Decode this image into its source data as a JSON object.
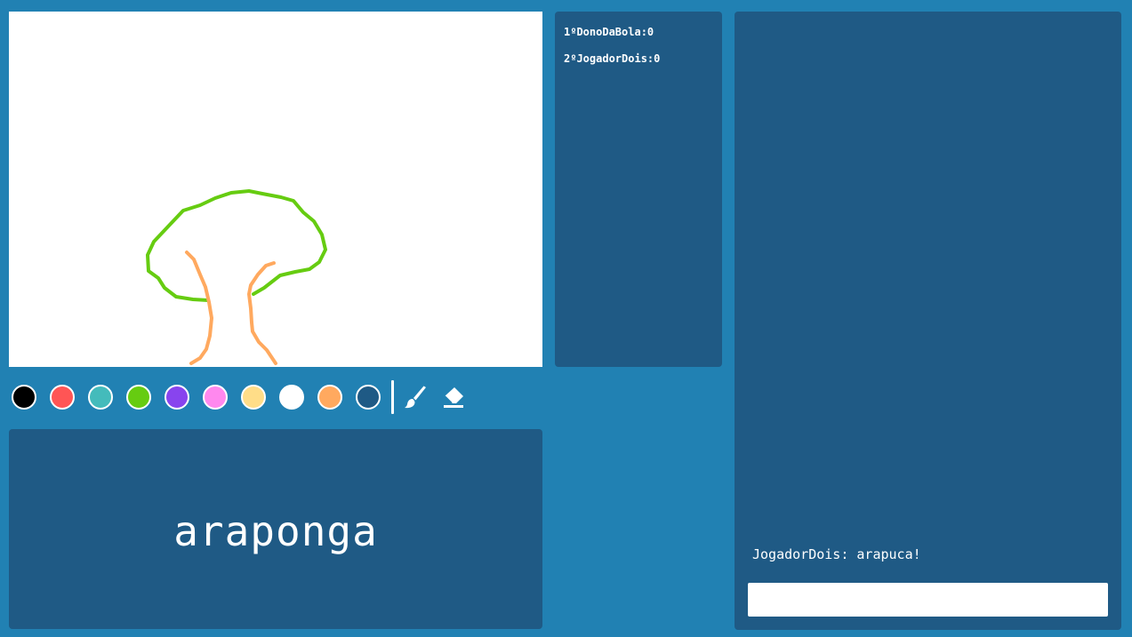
{
  "colors": {
    "background": "#2181b3",
    "panel": "#1f5a85",
    "canvas": "#ffffff",
    "stroke_green": "#66cc11",
    "stroke_orange": "#ffa95f"
  },
  "palette": [
    {
      "name": "black",
      "color": "#000000"
    },
    {
      "name": "red",
      "color": "#ff5555"
    },
    {
      "name": "teal",
      "color": "#44bbbb"
    },
    {
      "name": "green",
      "color": "#66cc11"
    },
    {
      "name": "purple",
      "color": "#8844ee"
    },
    {
      "name": "pink",
      "color": "#ff88ee"
    },
    {
      "name": "yellow",
      "color": "#ffdd88"
    },
    {
      "name": "white",
      "color": "#ffffff"
    },
    {
      "name": "orange",
      "color": "#ffa95f"
    },
    {
      "name": "navy",
      "color": "#1f5a85"
    }
  ],
  "tools": {
    "brush_icon": "brush-icon",
    "eraser_icon": "eraser-icon"
  },
  "word": "araponga",
  "scoreboard": {
    "players": [
      {
        "label": "1ºDonoDaBola:0"
      },
      {
        "label": "2ºJogadorDois:0"
      }
    ]
  },
  "chat": {
    "messages": [
      {
        "text": "JogadorDois: arapuca!"
      }
    ],
    "input_value": "",
    "input_placeholder": ""
  }
}
